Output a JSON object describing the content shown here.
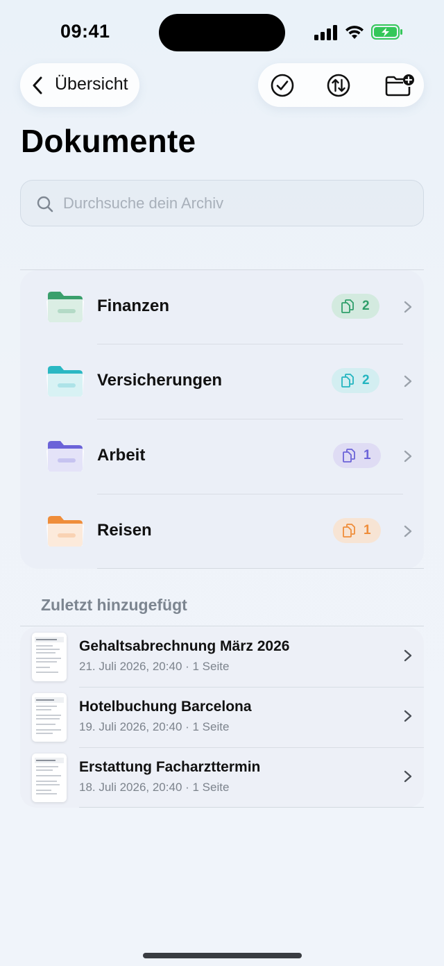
{
  "status_bar": {
    "time": "09:41"
  },
  "nav": {
    "back_label": "Übersicht",
    "actions": [
      "select-icon",
      "sort-icon",
      "new-folder-icon"
    ]
  },
  "page": {
    "title": "Dokumente"
  },
  "search": {
    "placeholder": "Durchsuche dein Archiv"
  },
  "folders": [
    {
      "label": "Finanzen",
      "count": "2",
      "color": "#2f9e6a",
      "badge_bg": "#d3eadf"
    },
    {
      "label": "Versicherungen",
      "count": "2",
      "color": "#23b5c0",
      "badge_bg": "#d3eef1"
    },
    {
      "label": "Arbeit",
      "count": "1",
      "color": "#6b63d8",
      "badge_bg": "#dfdcf4"
    },
    {
      "label": "Reisen",
      "count": "1",
      "color": "#ef8d3a",
      "badge_bg": "#f7e4d4"
    }
  ],
  "recent": {
    "title": "Zuletzt hinzugefügt",
    "items": [
      {
        "title": "Gehaltsabrechnung März 2026",
        "meta": "21. Juli 2026, 20:40 · 1 Seite"
      },
      {
        "title": "Hotelbuchung Barcelona",
        "meta": "19. Juli 2026, 20:40 · 1 Seite"
      },
      {
        "title": "Erstattung Facharzttermin",
        "meta": "18. Juli 2026, 20:40 · 1 Seite"
      }
    ]
  }
}
